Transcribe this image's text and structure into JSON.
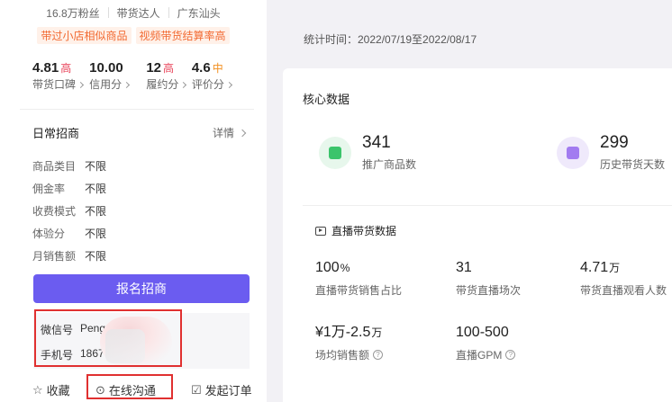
{
  "profile": {
    "fans": "16.8万粉丝",
    "role": "带货达人",
    "location": "广东汕头",
    "tags": [
      "带过小店相似商品",
      "视频带货结算率高"
    ]
  },
  "scores": [
    {
      "value": "4.81",
      "grade": "高",
      "grade_level": "high",
      "label": "带货口碑"
    },
    {
      "value": "10.00",
      "grade": "",
      "grade_level": "",
      "label": "信用分"
    },
    {
      "value": "12",
      "grade": "高",
      "grade_level": "high",
      "label": "履约分"
    },
    {
      "value": "4.6",
      "grade": "中",
      "grade_level": "mid",
      "label": "评价分"
    }
  ],
  "recruit": {
    "title": "日常招商",
    "detail_link": "详情",
    "items": [
      {
        "key": "商品类目",
        "value": "不限"
      },
      {
        "key": "佣金率",
        "value": "不限"
      },
      {
        "key": "收费模式",
        "value": "不限"
      },
      {
        "key": "体验分",
        "value": "不限"
      },
      {
        "key": "月销售额",
        "value": "不限"
      }
    ],
    "apply_button": "报名招商"
  },
  "contact": {
    "wechat_label": "微信号",
    "wechat_value": "Peng",
    "phone_label": "手机号",
    "phone_value": "1867"
  },
  "actions": {
    "favorite": "收藏",
    "chat": "在线沟通",
    "order": "发起订单"
  },
  "stats": {
    "time_range": "统计时间：2022/07/19至2022/08/17",
    "core_title": "核心数据",
    "kpis": [
      {
        "value": "341",
        "label": "推广商品数"
      },
      {
        "value": "299",
        "label": "历史带货天数"
      }
    ],
    "live_title": "直播带货数据",
    "metrics": [
      {
        "value": "100",
        "unit": "%",
        "label": "直播带货销售占比",
        "help": false
      },
      {
        "value": "31",
        "unit": "",
        "label": "带货直播场次",
        "help": false
      },
      {
        "value": "4.71",
        "unit": "万",
        "label": "带货直播观看人数",
        "help": false
      },
      {
        "value": "¥1万-2.5",
        "unit": "万",
        "label": "场均销售额",
        "help": true
      },
      {
        "value": "100-500",
        "unit": "",
        "label": "直播GPM",
        "help": true
      }
    ]
  },
  "colors": {
    "accent": "#6b5cf0",
    "tag": "#f26a32",
    "grade_high": "#e8445a",
    "grade_mid": "#f29020",
    "highlight_outline": "#e03030"
  }
}
